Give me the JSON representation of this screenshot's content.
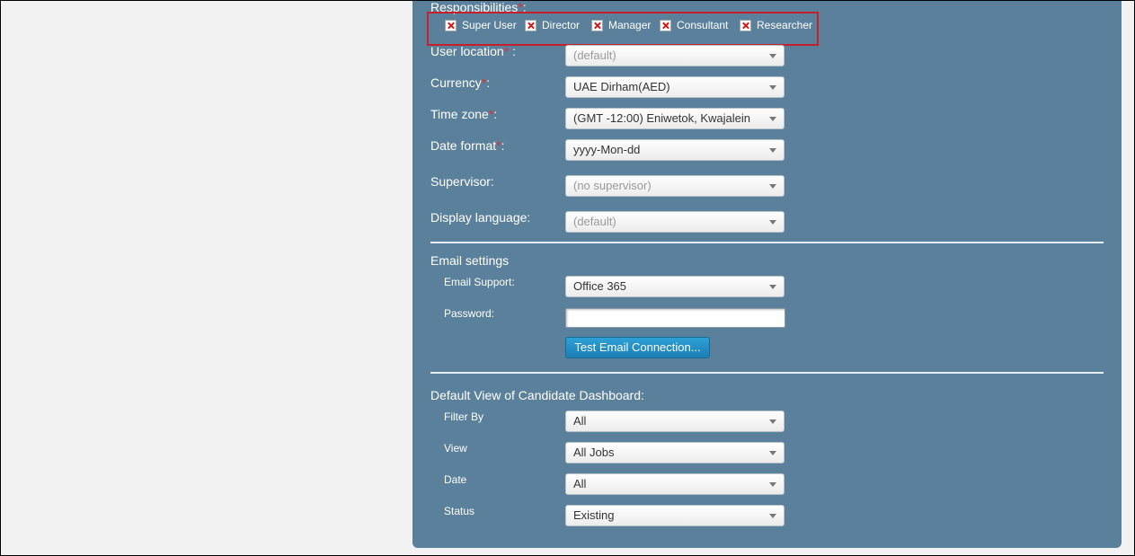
{
  "responsibilities": {
    "label": "Responsibilities",
    "required_mark": "*",
    "colon": ":",
    "options": [
      {
        "label": "Super User",
        "checked": true
      },
      {
        "label": "Director",
        "checked": true
      },
      {
        "label": "Manager",
        "checked": true
      },
      {
        "label": "Consultant",
        "checked": true
      },
      {
        "label": "Researcher",
        "checked": true
      }
    ]
  },
  "user_location": {
    "label": "User location",
    "required_mark": "*",
    "colon": " :",
    "value": "(default)"
  },
  "currency": {
    "label": "Currency",
    "required_mark": "*",
    "colon": ":",
    "value": "UAE Dirham(AED)"
  },
  "time_zone": {
    "label": "Time zone",
    "required_mark": "*",
    "colon": ":",
    "value": "(GMT -12:00) Eniwetok, Kwajalein"
  },
  "date_format": {
    "label": "Date format",
    "required_mark": "*",
    "colon": ":",
    "value": "yyyy-Mon-dd"
  },
  "supervisor": {
    "label": "Supervisor:",
    "value": "(no supervisor)"
  },
  "display_language": {
    "label": "Display language:",
    "value": "(default)"
  },
  "email_settings": {
    "title": "Email settings",
    "support_label": "Email Support:",
    "support_value": "Office 365",
    "password_label": "Password:",
    "password_value": "",
    "test_button": "Test Email Connection..."
  },
  "dashboard": {
    "title": "Default View of Candidate Dashboard:",
    "filter_by_label": "Filter By",
    "filter_by_value": "All",
    "view_label": "View",
    "view_value": "All Jobs",
    "date_label": "Date",
    "date_value": "All",
    "status_label": "Status",
    "status_value": "Existing"
  },
  "colors": {
    "panel": "#5b809b",
    "page_bg": "#f2f2f2",
    "required": "#e03030",
    "highlight_border": "#c8202a",
    "button": "#1f8cc4"
  }
}
